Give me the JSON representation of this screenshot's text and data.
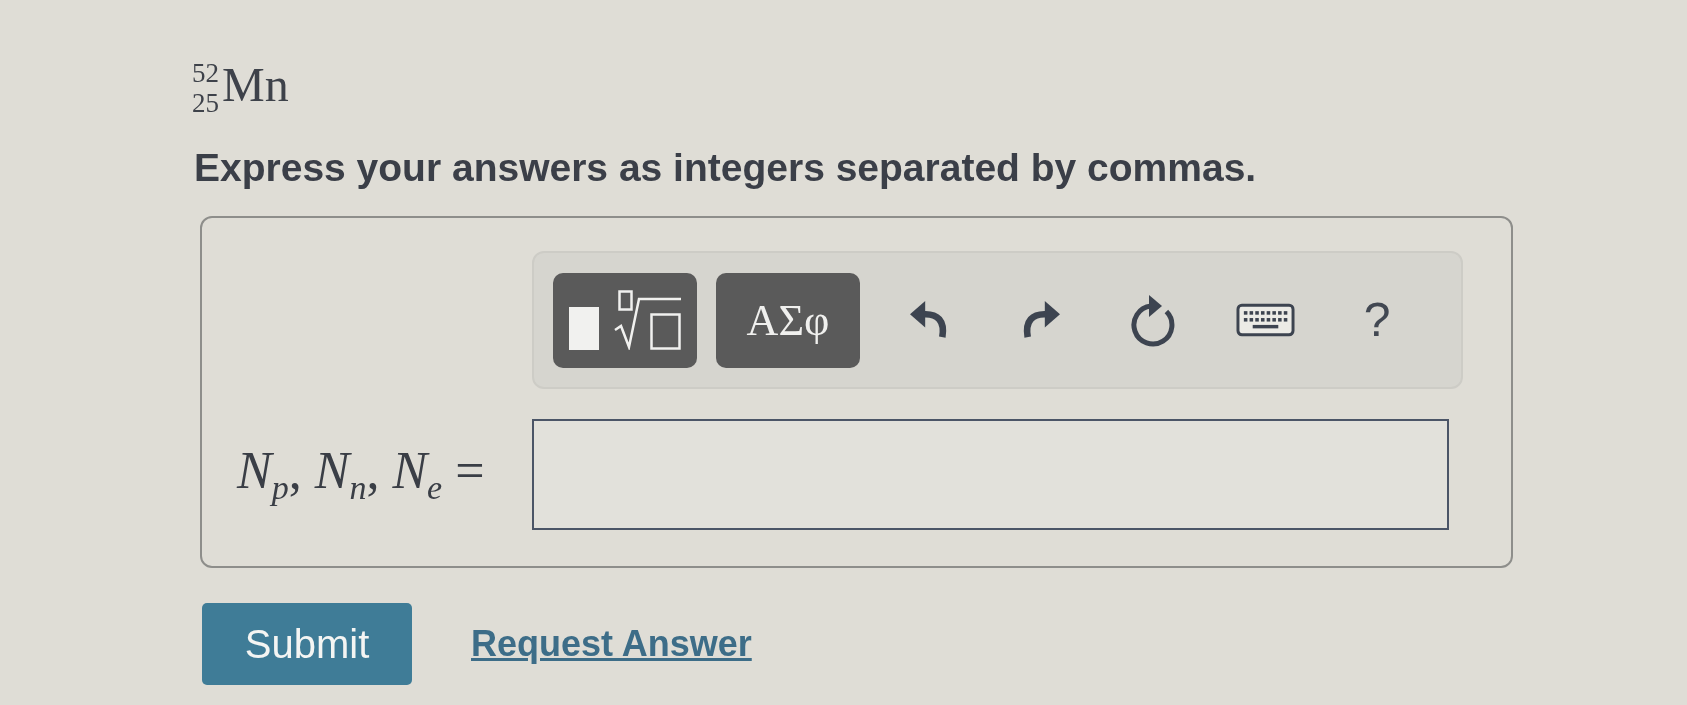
{
  "nuclide": {
    "mass_number": "52",
    "atomic_number": "25",
    "symbol": "Mn"
  },
  "instruction": "Express your answers as integers separated by commas.",
  "answer_box": {
    "toolbar": [
      {
        "kind": "templates"
      },
      {
        "kind": "symbols",
        "label": "ΑΣφ"
      },
      {
        "kind": "undo"
      },
      {
        "kind": "redo"
      },
      {
        "kind": "reset"
      },
      {
        "kind": "keyboard"
      },
      {
        "kind": "help",
        "label": "?"
      }
    ],
    "label": "*N*$_{p}$, *N*$_{n}$, *N*$_{e}$ ="
  },
  "actions": [
    {
      "kind": "button",
      "label": "Submit"
    },
    {
      "kind": "link",
      "label": "Request Answer"
    }
  ]
}
